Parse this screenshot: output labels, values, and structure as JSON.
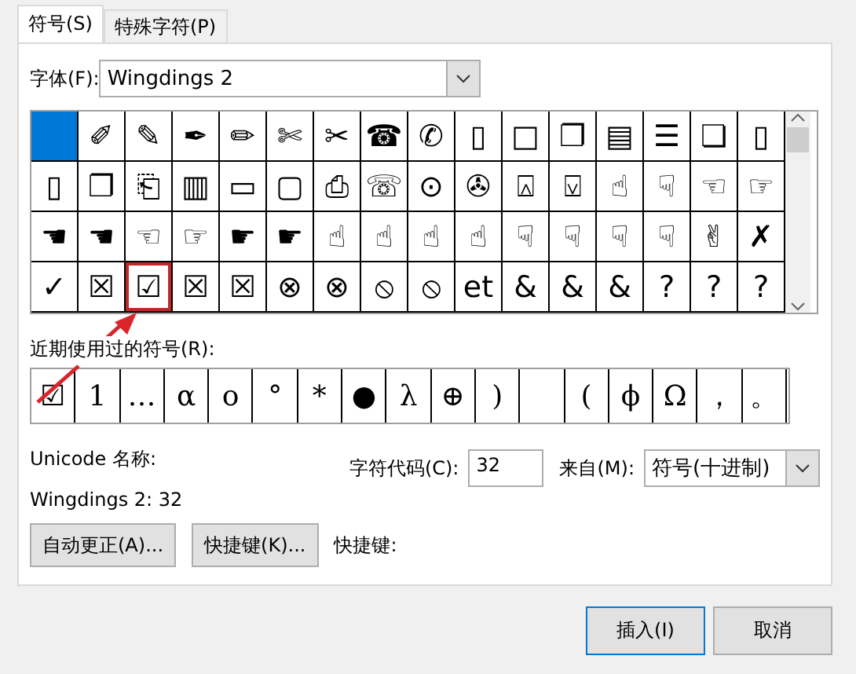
{
  "tabs": [
    {
      "label": "符号(S)",
      "selected": true
    },
    {
      "label": "特殊字符(P)",
      "selected": false
    }
  ],
  "font": {
    "label": "字体(F):",
    "value": "Wingdings 2"
  },
  "symbol_grid": {
    "rows": [
      [
        {
          "selected": true,
          "marked": false
        },
        {
          "glyph": "✐",
          "selected": false,
          "marked": false
        },
        {
          "glyph": "✎",
          "selected": false,
          "marked": false
        },
        {
          "glyph": "✒",
          "selected": false,
          "marked": false
        },
        {
          "glyph": "✏",
          "selected": false,
          "marked": false
        },
        {
          "glyph": "✄",
          "selected": false,
          "marked": false
        },
        {
          "glyph": "✂",
          "selected": false,
          "marked": false
        },
        {
          "glyph": "☎",
          "selected": false,
          "marked": false
        },
        {
          "glyph": "✆",
          "selected": false,
          "marked": false
        },
        {
          "glyph": "▯",
          "selected": false,
          "marked": false
        },
        {
          "glyph": "□",
          "selected": false,
          "marked": false
        },
        {
          "glyph": "❐",
          "selected": false,
          "marked": false
        },
        {
          "glyph": "▤",
          "selected": false,
          "marked": false
        },
        {
          "glyph": "☰",
          "selected": false,
          "marked": false
        },
        {
          "glyph": "❏",
          "selected": false,
          "marked": false
        },
        {
          "glyph": "▯",
          "selected": false,
          "marked": false
        }
      ],
      [
        {
          "glyph": "▯",
          "selected": false,
          "marked": false
        },
        {
          "glyph": "❐",
          "selected": false,
          "marked": false
        },
        {
          "glyph": "⎗",
          "selected": false,
          "marked": false
        },
        {
          "glyph": "▥",
          "selected": false,
          "marked": false
        },
        {
          "glyph": "▭",
          "selected": false,
          "marked": false
        },
        {
          "glyph": "▢",
          "selected": false,
          "marked": false
        },
        {
          "glyph": "⎙",
          "selected": false,
          "marked": false
        },
        {
          "glyph": "☏",
          "selected": false,
          "marked": false
        },
        {
          "glyph": "⊙",
          "selected": false,
          "marked": false
        },
        {
          "glyph": "✇",
          "selected": false,
          "marked": false
        },
        {
          "glyph": "⍓",
          "selected": false,
          "marked": false
        },
        {
          "glyph": "⍌",
          "selected": false,
          "marked": false
        },
        {
          "glyph": "☝",
          "selected": false,
          "marked": false
        },
        {
          "glyph": "☟",
          "selected": false,
          "marked": false
        },
        {
          "glyph": "☜",
          "selected": false,
          "marked": false
        },
        {
          "glyph": "☞",
          "selected": false,
          "marked": false
        }
      ],
      [
        {
          "glyph": "☚",
          "selected": false,
          "marked": false
        },
        {
          "glyph": "☚",
          "selected": false,
          "marked": false
        },
        {
          "glyph": "☜",
          "selected": false,
          "marked": false
        },
        {
          "glyph": "☞",
          "selected": false,
          "marked": false
        },
        {
          "glyph": "☛",
          "selected": false,
          "marked": false
        },
        {
          "glyph": "☛",
          "selected": false,
          "marked": false
        },
        {
          "glyph": "☝",
          "selected": false,
          "marked": false
        },
        {
          "glyph": "☝",
          "selected": false,
          "marked": false
        },
        {
          "glyph": "☝",
          "selected": false,
          "marked": false
        },
        {
          "glyph": "☝",
          "selected": false,
          "marked": false
        },
        {
          "glyph": "☟",
          "selected": false,
          "marked": false
        },
        {
          "glyph": "☟",
          "selected": false,
          "marked": false
        },
        {
          "glyph": "☟",
          "selected": false,
          "marked": false
        },
        {
          "glyph": "☟",
          "selected": false,
          "marked": false
        },
        {
          "glyph": "✌",
          "selected": false,
          "marked": false
        },
        {
          "glyph": "✗",
          "selected": false,
          "marked": false
        }
      ],
      [
        {
          "glyph": "✓",
          "selected": false,
          "marked": false
        },
        {
          "glyph": "☒",
          "selected": false,
          "marked": false
        },
        {
          "glyph": "☑",
          "selected": false,
          "marked": true
        },
        {
          "glyph": "☒",
          "selected": false,
          "marked": false
        },
        {
          "glyph": "☒",
          "selected": false,
          "marked": false
        },
        {
          "glyph": "⊗",
          "selected": false,
          "marked": false
        },
        {
          "glyph": "⊗",
          "selected": false,
          "marked": false
        },
        {
          "glyph": "⦸",
          "selected": false,
          "marked": false
        },
        {
          "glyph": "⦸",
          "selected": false,
          "marked": false
        },
        {
          "glyph": "et",
          "selected": false,
          "marked": false
        },
        {
          "glyph": "&",
          "selected": false,
          "marked": false
        },
        {
          "glyph": "&",
          "selected": false,
          "marked": false
        },
        {
          "glyph": "&",
          "selected": false,
          "marked": false
        },
        {
          "glyph": "?",
          "selected": false,
          "marked": false
        },
        {
          "glyph": "?",
          "selected": false,
          "marked": false
        },
        {
          "glyph": "?",
          "selected": false,
          "marked": false
        }
      ]
    ]
  },
  "recent": {
    "label": "近期使用过的符号(R):",
    "symbols": [
      {
        "glyph": "☑"
      },
      {
        "glyph": "1"
      },
      {
        "glyph": "…"
      },
      {
        "glyph": "α"
      },
      {
        "glyph": "ο"
      },
      {
        "glyph": "°"
      },
      {
        "glyph": "*"
      },
      {
        "glyph": "●"
      },
      {
        "glyph": "λ"
      },
      {
        "glyph": "⊕"
      },
      {
        "glyph": ")"
      }
    ],
    "symbols_after_blank": [
      {
        "glyph": "("
      },
      {
        "glyph": "ϕ"
      },
      {
        "glyph": "Ω"
      },
      {
        "glyph": "，"
      },
      {
        "glyph": "。"
      }
    ]
  },
  "unicode_name_label": "Unicode 名称:",
  "unicode_name": "Wingdings 2: 32",
  "char_code": {
    "label": "字符代码(C):",
    "value": "32"
  },
  "from": {
    "label": "来自(M):",
    "value": "符号(十进制)"
  },
  "buttons": [
    {
      "label": "自动更正(A)..."
    },
    {
      "label": "快捷键(K)..."
    }
  ],
  "shortcut_label": "快捷键:",
  "footer_buttons": [
    {
      "label": "插入(I)",
      "default": true
    },
    {
      "label": "取消",
      "default": false
    }
  ]
}
